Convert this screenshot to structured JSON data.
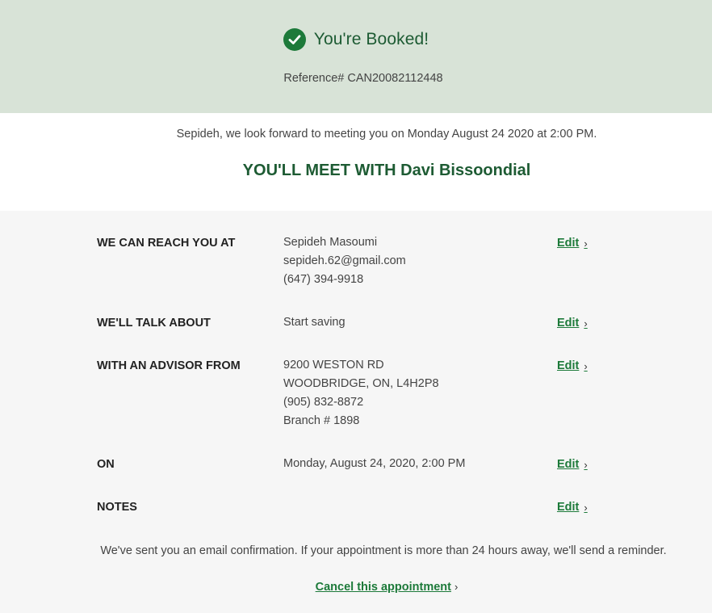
{
  "banner": {
    "title": "You're Booked!",
    "reference_label": "Reference#",
    "reference_number": "CAN20082112448",
    "background": "#d8e3d7",
    "accent": "#1d7a3a"
  },
  "intro": {
    "message": "Sepideh, we look forward to meeting you on Monday August 24 2020 at 2:00 PM.",
    "meet_heading": "YOU'LL MEET WITH Davi Bissoondial"
  },
  "details": {
    "reach": {
      "label": "WE CAN REACH YOU AT",
      "name": "Sepideh Masoumi",
      "email": "sepideh.62@gmail.com",
      "phone": "(647) 394-9918",
      "edit_label": "Edit"
    },
    "topic": {
      "label": "WE'LL TALK ABOUT",
      "value": "Start saving",
      "edit_label": "Edit"
    },
    "branch": {
      "label": "WITH AN ADVISOR FROM",
      "street": "9200 WESTON RD",
      "city": "WOODBRIDGE, ON, L4H2P8",
      "phone": "(905) 832-8872",
      "branch_no": "Branch # 1898",
      "edit_label": "Edit"
    },
    "date": {
      "label": "ON",
      "value": "Monday, August 24, 2020, 2:00 PM",
      "edit_label": "Edit"
    },
    "notes": {
      "label": "NOTES",
      "edit_label": "Edit"
    }
  },
  "footer": {
    "confirmation_note": "We've sent you an email confirmation. If your appointment is more than 24 hours away, we'll send a reminder.",
    "cancel_label": "Cancel this appointment"
  }
}
